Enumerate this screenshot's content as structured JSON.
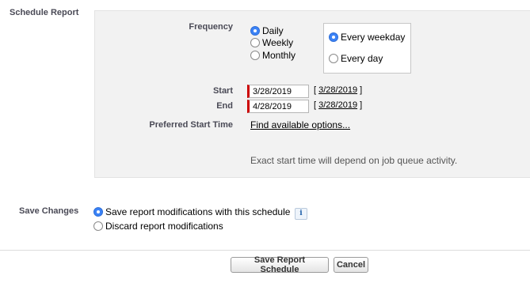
{
  "schedule": {
    "section_label": "Schedule Report",
    "frequency_label": "Frequency",
    "frequency_options": [
      "Daily",
      "Weekly",
      "Monthly"
    ],
    "frequency_selected": "Daily",
    "daily_options": [
      "Every weekday",
      "Every day"
    ],
    "daily_selected": "Every weekday",
    "start_label": "Start",
    "start_value": "3/28/2019",
    "start_today_link": "3/28/2019",
    "end_label": "End",
    "end_value": "4/28/2019",
    "end_today_link": "3/28/2019",
    "bracket_open": "[",
    "bracket_close": "]",
    "preferred_start_label": "Preferred Start Time",
    "find_options_link": "Find available options...",
    "hint": "Exact start time will depend on job queue activity."
  },
  "save_changes": {
    "label": "Save Changes",
    "options": [
      "Save report modifications with this schedule",
      "Discard report modifications"
    ],
    "selected": "Save report modifications with this schedule",
    "info_icon": "i"
  },
  "buttons": {
    "save": "Save Report Schedule",
    "cancel": "Cancel"
  },
  "colors": {
    "radio_selected": "#3b82f6",
    "required_marker": "#cc0000",
    "panel_bg": "#f2f2f2"
  }
}
